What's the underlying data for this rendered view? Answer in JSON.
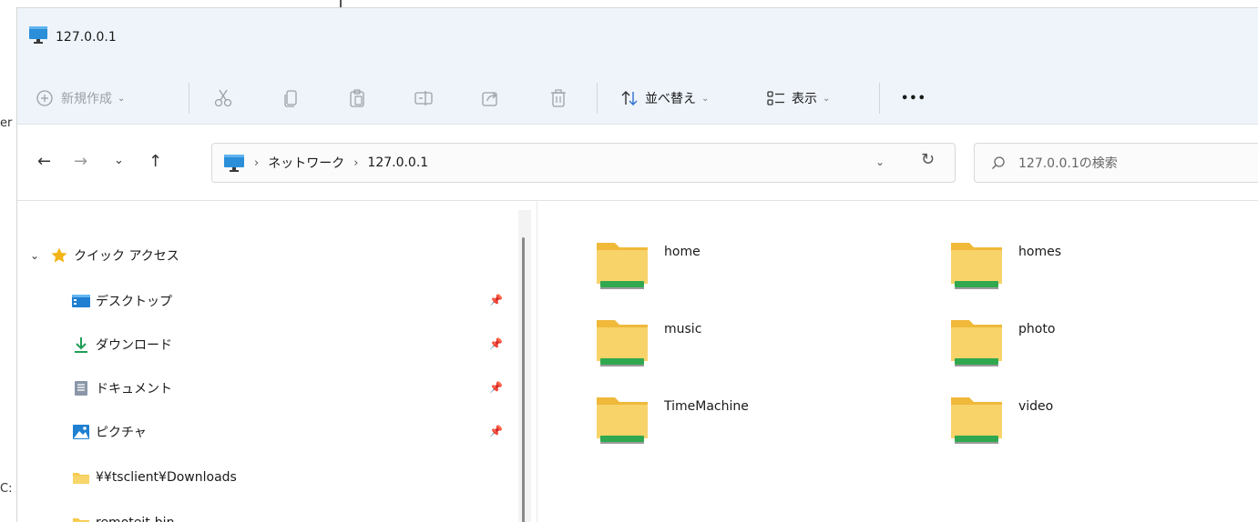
{
  "background": {
    "fragments": [
      "er",
      "C:"
    ]
  },
  "window": {
    "title": "127.0.0.1"
  },
  "toolbar": {
    "new_label": "新規作成",
    "sort_label": "並べ替え",
    "view_label": "表示",
    "more_label": "•••"
  },
  "address": {
    "back": "←",
    "forward": "→",
    "recent": "⌄",
    "up": "↑",
    "crumbs": [
      "ネットワーク",
      "127.0.0.1"
    ],
    "separator": "›",
    "dropdown": "⌄",
    "refresh": "↻"
  },
  "search": {
    "placeholder": "127.0.0.1の検索"
  },
  "sidebar": {
    "quick_access": "クイック アクセス",
    "items": [
      {
        "label": "デスクトップ",
        "icon": "desktop-icon",
        "pinned": true
      },
      {
        "label": "ダウンロード",
        "icon": "download-icon",
        "pinned": true
      },
      {
        "label": "ドキュメント",
        "icon": "document-icon",
        "pinned": true
      },
      {
        "label": "ピクチャ",
        "icon": "picture-icon",
        "pinned": true
      },
      {
        "label": "¥¥tsclient¥Downloads",
        "icon": "folder-icon",
        "pinned": false
      },
      {
        "label": "remoteit-bin",
        "icon": "folder-icon",
        "pinned": false
      }
    ]
  },
  "folders": [
    "home",
    "homes",
    "music",
    "photo",
    "TimeMachine",
    "video"
  ],
  "colors": {
    "toolbar_bg": "#eef4fa",
    "folder_yellow": "#f6c94a",
    "share_green": "#2fa84f",
    "star": "#f2b416"
  }
}
